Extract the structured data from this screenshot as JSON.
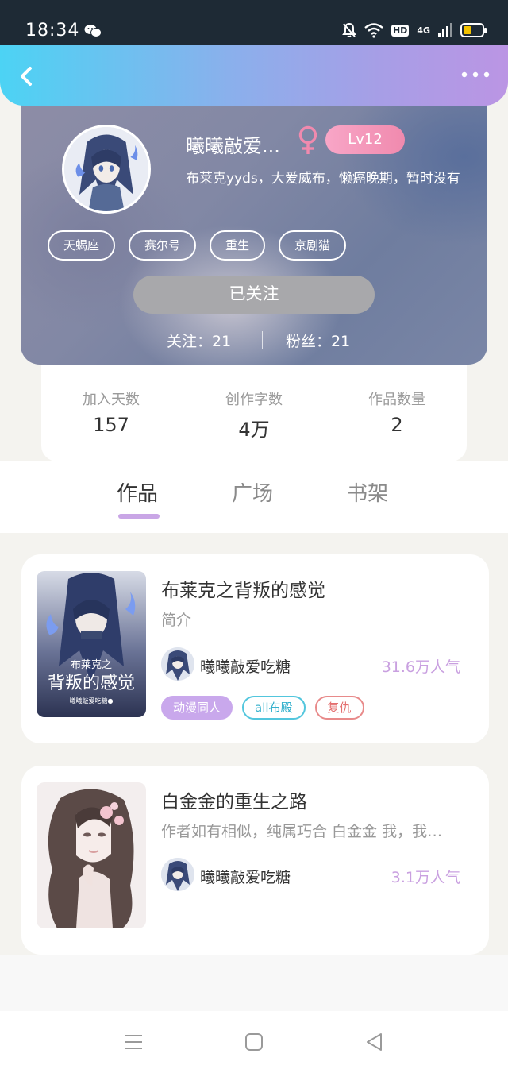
{
  "status_bar": {
    "time": "18:34",
    "hd": "HD",
    "network": "4G",
    "battery_level": 0.45,
    "icons": [
      "wechat-icon",
      "bell-muted-icon",
      "wifi-icon",
      "signal-icon",
      "battery-icon"
    ]
  },
  "header": {
    "back_icon": "chevron-left-icon",
    "more_icon": "more-dots-icon",
    "gradient": [
      "#4cd3f4",
      "#bb95e4"
    ]
  },
  "profile": {
    "name": "曦曦敲爱...",
    "gender": "♀",
    "gender_color": "#f08aae",
    "level": "Lv12",
    "bio": "布莱克yyds，大爱威布，懒癌晚期，暂时没有",
    "tags": [
      "天蝎座",
      "赛尔号",
      "重生",
      "京剧猫"
    ],
    "follow_button": "已关注",
    "following_label": "关注：21",
    "followers_label": "粉丝：21"
  },
  "stats": [
    {
      "label": "加入天数",
      "value": "157"
    },
    {
      "label": "创作字数",
      "value": "4万"
    },
    {
      "label": "作品数量",
      "value": "2"
    }
  ],
  "tabs": [
    {
      "label": "作品",
      "active": true
    },
    {
      "label": "广场",
      "active": false
    },
    {
      "label": "书架",
      "active": false
    }
  ],
  "books": [
    {
      "title": "布莱克之背叛的感觉",
      "description": "简介",
      "author": "曦曦敲爱吃糖",
      "popularity": "31.6万人气",
      "genres": [
        "动漫同人",
        "all布殿",
        "复仇"
      ],
      "cover_text": "布莱克之",
      "cover_subtext": "背叛的感觉",
      "cover_author": "曦曦敲爱吃糖●"
    },
    {
      "title": "白金金的重生之路",
      "description": "作者如有相似，纯属巧合 白金金 我，我…",
      "author": "曦曦敲爱吃糖",
      "popularity": "3.1万人气",
      "genres": []
    }
  ],
  "nav": {
    "items": [
      "menu-icon",
      "home-square-icon",
      "back-triangle-icon"
    ]
  },
  "colors": {
    "accent": "#c9a6e6",
    "popularity": "#c9a0e0",
    "follow_button_bg": "#a8a8ab"
  }
}
